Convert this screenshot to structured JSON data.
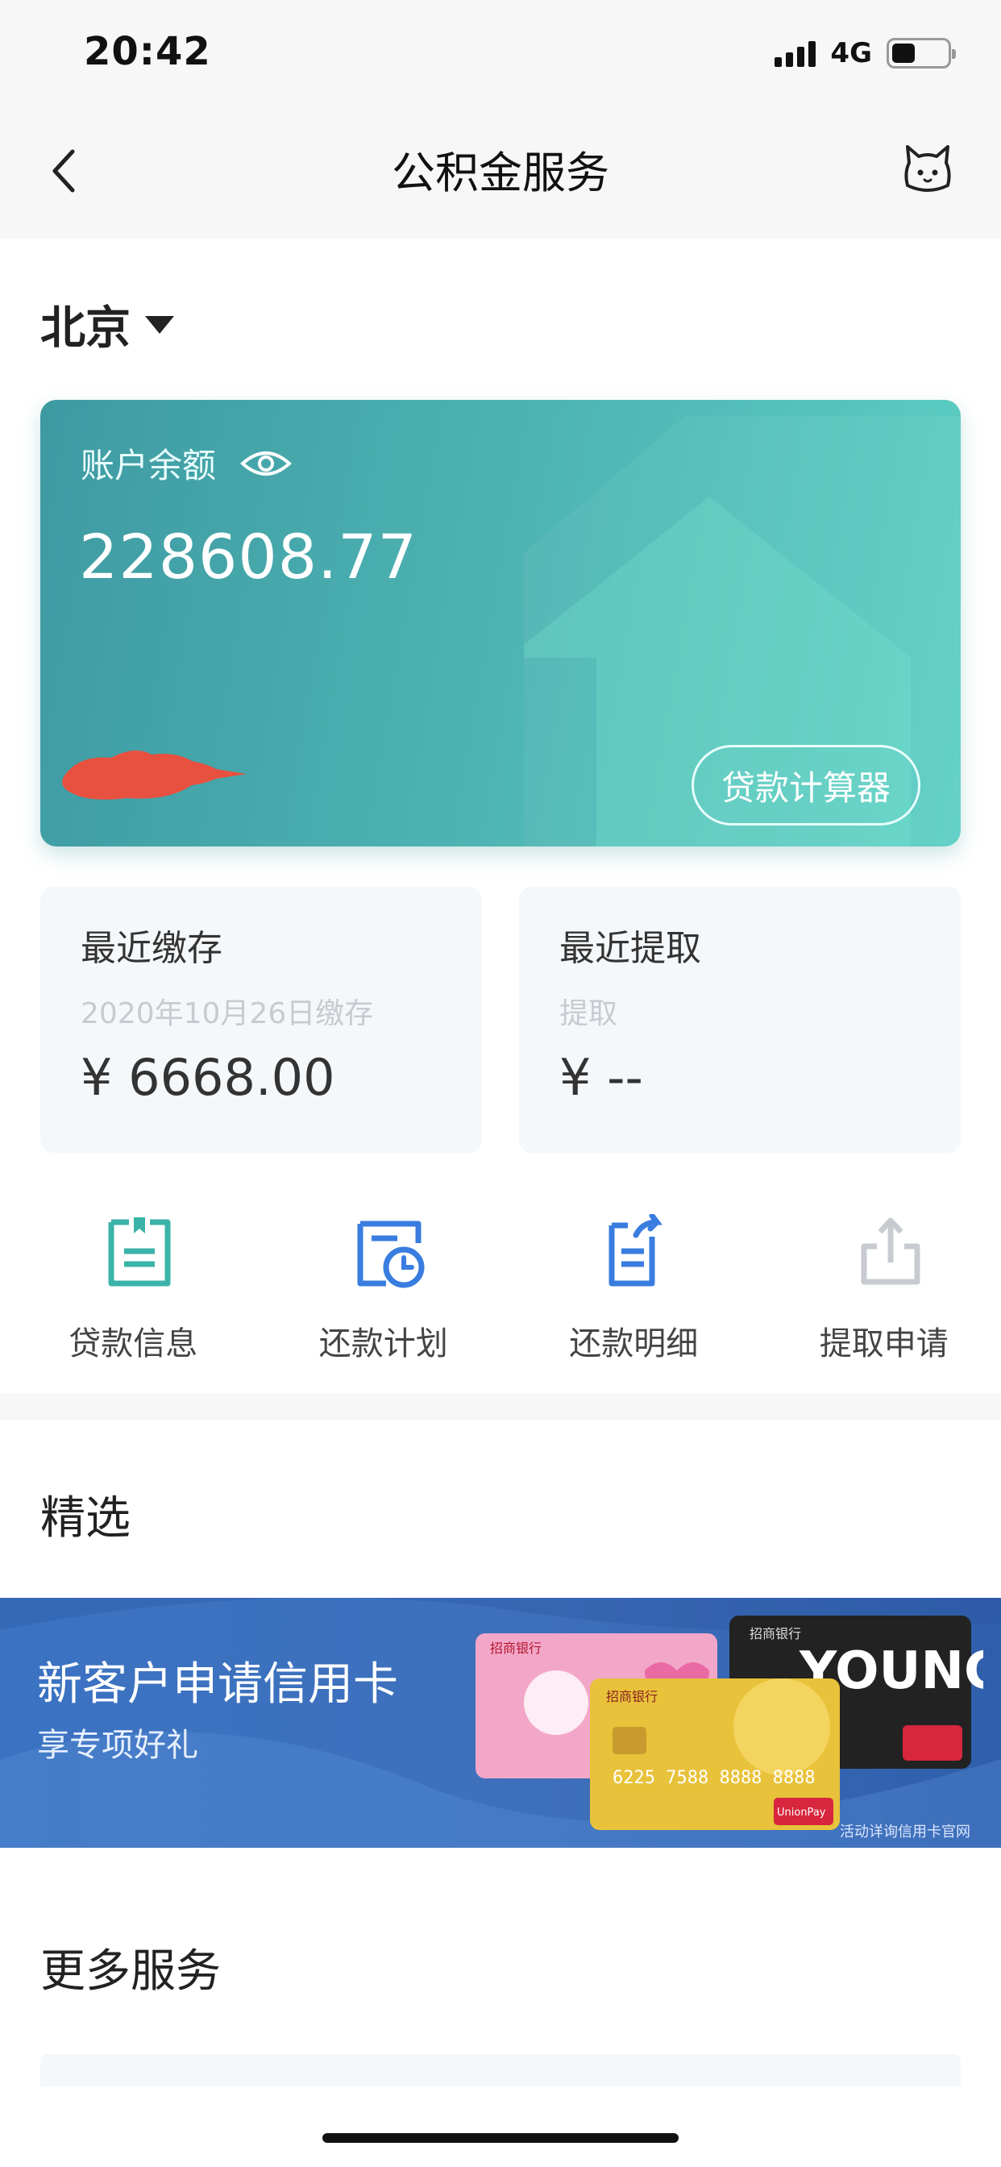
{
  "status_bar": {
    "time": "20:42",
    "network": "4G"
  },
  "nav": {
    "title": "公积金服务"
  },
  "city": {
    "name": "北京"
  },
  "balance": {
    "label": "账户余额",
    "value": "228608.77",
    "calculator_label": "贷款计算器"
  },
  "recent_deposit": {
    "title": "最近缴存",
    "subtitle": "2020年10月26日缴存",
    "amount": "¥ 6668.00"
  },
  "recent_withdrawal": {
    "title": "最近提取",
    "subtitle": "提取",
    "amount": "¥ --"
  },
  "actions": [
    {
      "label": "贷款信息",
      "icon": "loan-info-icon"
    },
    {
      "label": "还款计划",
      "icon": "repayment-plan-icon"
    },
    {
      "label": "还款明细",
      "icon": "repayment-details-icon"
    },
    {
      "label": "提取申请",
      "icon": "withdraw-apply-icon"
    }
  ],
  "featured": {
    "title": "精选",
    "banner_title": "新客户申请信用卡",
    "banner_subtitle": "享专项好礼",
    "banner_note": "活动详询信用卡官网",
    "card_texts": {
      "bank": "招商银行",
      "young": "YOUNG",
      "number": "6225 7588 8888 8888",
      "unionpay": "UnionPay"
    }
  },
  "more": {
    "title": "更多服务"
  },
  "colors": {
    "card_start": "#3e9aa2",
    "card_end": "#5ccfc4",
    "icon_teal": "#3bb3a8",
    "icon_blue": "#3a7de0",
    "icon_disabled": "#c8ccd1"
  }
}
